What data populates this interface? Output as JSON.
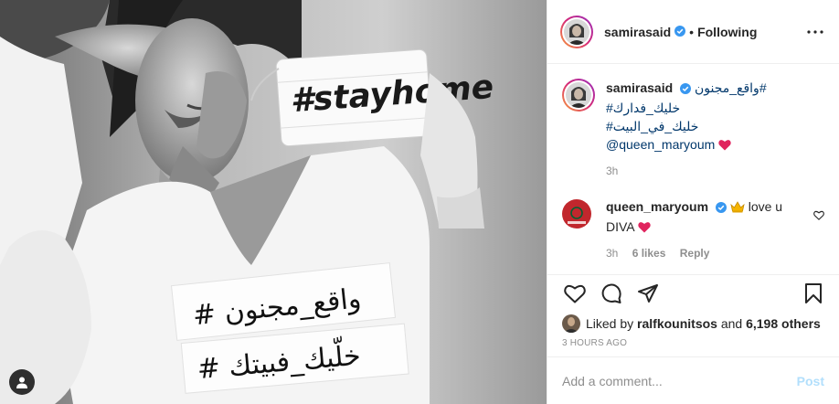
{
  "post": {
    "author": "samirasaid",
    "follow_status": "Following",
    "dot": "•",
    "caption_lines": [
      "واقع_مجنون#",
      "#خليك_فدارك",
      "#خليك_في_البيت",
      "@queen_maryoum"
    ],
    "caption_time": "3h",
    "image": {
      "mask_text": "#stayhome",
      "shirt_line1": "# واقع_مجنون",
      "shirt_line2": "# خلّيك_فبيتك"
    }
  },
  "comments": [
    {
      "author": "queen_maryoum",
      "text_line1": "love u",
      "text_line2": "DIVA",
      "time": "3h",
      "likes": "6 likes",
      "reply": "Reply"
    }
  ],
  "likes": {
    "prefix": "Liked by",
    "user": "ralfkounitsos",
    "and": "and",
    "others": "6,198 others"
  },
  "time_ago": "3 HOURS AGO",
  "add_comment": {
    "placeholder": "Add a comment...",
    "post_label": "Post"
  },
  "colors": {
    "link": "#00376b",
    "muted": "#8e8e8e",
    "verified": "#3897f0",
    "heart": "#ed4956",
    "post_button": "#b2dffc"
  },
  "icons": [
    "heart-icon",
    "comment-icon",
    "share-icon",
    "save-icon",
    "more-icon",
    "verified-icon",
    "tag-user-icon"
  ]
}
